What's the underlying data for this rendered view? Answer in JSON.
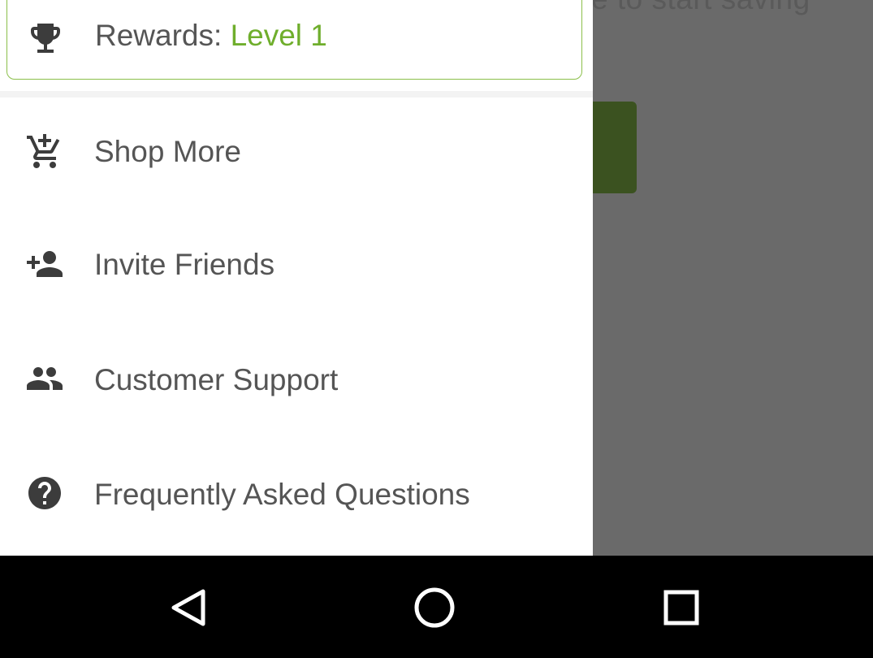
{
  "background": {
    "partial_text": "e to start saving"
  },
  "drawer": {
    "rewards": {
      "prefix": "Rewards:",
      "level": "Level 1",
      "icon": "trophy-icon"
    },
    "items": [
      {
        "label": "Shop More",
        "icon": "add-shopping-cart-icon"
      },
      {
        "label": "Invite Friends",
        "icon": "person-add-icon"
      },
      {
        "label": "Customer Support",
        "icon": "people-icon"
      },
      {
        "label": "Frequently Asked Questions",
        "icon": "help-circle-icon"
      }
    ]
  },
  "colors": {
    "accent": "#6fae2c",
    "scrim": "#6a6a6a",
    "icon": "#3c3c3c",
    "text": "#555555"
  },
  "system_nav": {
    "back": "back-triangle-icon",
    "home": "home-circle-icon",
    "recents": "recents-square-icon"
  }
}
